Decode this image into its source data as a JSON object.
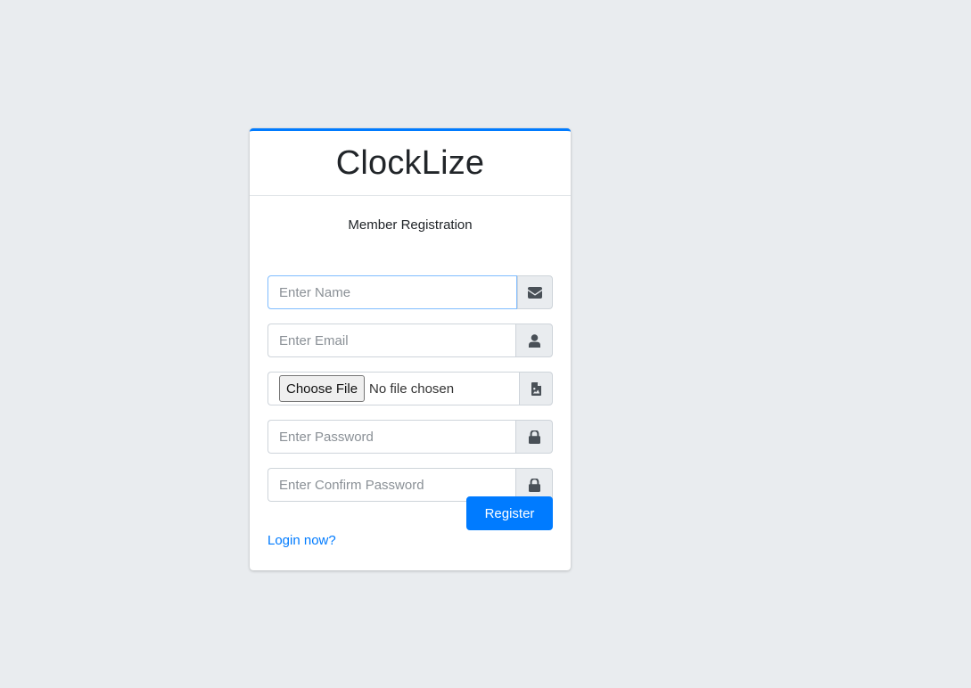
{
  "brand": {
    "title": "ClockLize"
  },
  "form": {
    "subtitle": "Member Registration",
    "name_placeholder": "Enter Name",
    "email_placeholder": "Enter Email",
    "file_button": "Choose File",
    "file_status": "No file chosen",
    "password_placeholder": "Enter Password",
    "confirm_password_placeholder": "Enter Confirm Password",
    "register_label": "Register",
    "login_link": "Login now?"
  },
  "icons": {
    "name_addon": "envelope-icon",
    "email_addon": "user-icon",
    "file_addon": "file-image-icon",
    "password_addon": "lock-icon",
    "confirm_password_addon": "lock-icon"
  },
  "colors": {
    "background": "#e9ecef",
    "accent": "#007bff",
    "focus_border": "#80bdff"
  }
}
